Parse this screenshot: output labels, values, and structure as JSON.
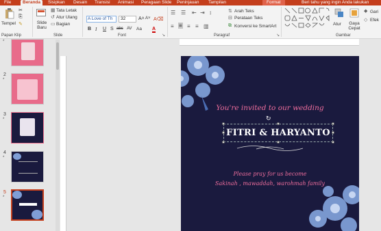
{
  "tabs": [
    "File",
    "Beranda",
    "Sisipkan",
    "Desain",
    "Transisi",
    "Animasi",
    "Peragaan Slide",
    "Peninjauan",
    "Tampilan",
    "Format",
    "Beri tahu yang ingin Anda lakukan"
  ],
  "ribbon": {
    "clipboard": {
      "paste": "Tempel",
      "group": "Papan Klip"
    },
    "slides": {
      "new_slide": "Slide Baru",
      "layout": "Tata Letak",
      "reset": "Atur Ulang",
      "section": "Bagian",
      "group": "Slide"
    },
    "font": {
      "name": "A Love of Th",
      "size": "32",
      "group": "Font",
      "bold": "B",
      "italic": "I",
      "underline": "U",
      "shadow": "S",
      "strike": "abc",
      "spacing": "AV",
      "case": "Aa",
      "clear": "A"
    },
    "paragraph": {
      "direction": "Arah Teks",
      "align": "Perataan Teks",
      "smartart": "Konversi ke SmartArt",
      "group": "Paragraf"
    },
    "drawing": {
      "arrange": "Atur",
      "quick_styles": "Gaya Cepat",
      "fill": "Gari",
      "effects": "Efek",
      "group": "Gambar"
    }
  },
  "thumbnails": [
    {
      "num": "",
      "star": "*"
    },
    {
      "num": "2",
      "star": "*"
    },
    {
      "num": "3",
      "star": "*"
    },
    {
      "num": "4",
      "star": "*"
    },
    {
      "num": "5",
      "star": "*"
    }
  ],
  "slide": {
    "invite": "You're invited to our wedding",
    "names": "FITRI & HARYANTO",
    "pray": "Please pray for us become",
    "sakinah": "Sakinah , mawaddah, warohmah family"
  },
  "colors": {
    "accent": "#c43e1c",
    "slide_bg": "#1a1a3e",
    "script_pink": "#f06e9d",
    "flower": "#7f9ed6"
  }
}
